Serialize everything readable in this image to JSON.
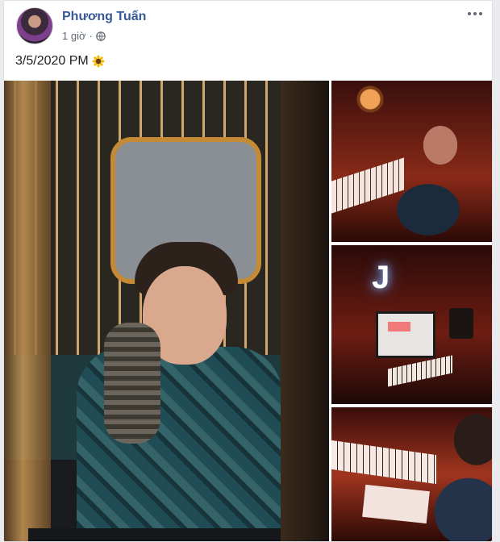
{
  "post": {
    "author": "Phương Tuấn",
    "time": "1 giờ",
    "separator": "·",
    "privacy_icon": "globe-icon",
    "more_icon": "more-options-icon",
    "caption": "3/5/2020 PM",
    "caption_emoji": "sunflower-icon"
  },
  "photos": [
    {
      "name": "main-photo"
    },
    {
      "name": "photo-keyboard"
    },
    {
      "name": "photo-studio-monitor",
      "overlay_letter": "J"
    },
    {
      "name": "photo-writing"
    }
  ],
  "colors": {
    "author_link": "#385898",
    "meta_text": "#606770",
    "background": "#e9ebee"
  }
}
